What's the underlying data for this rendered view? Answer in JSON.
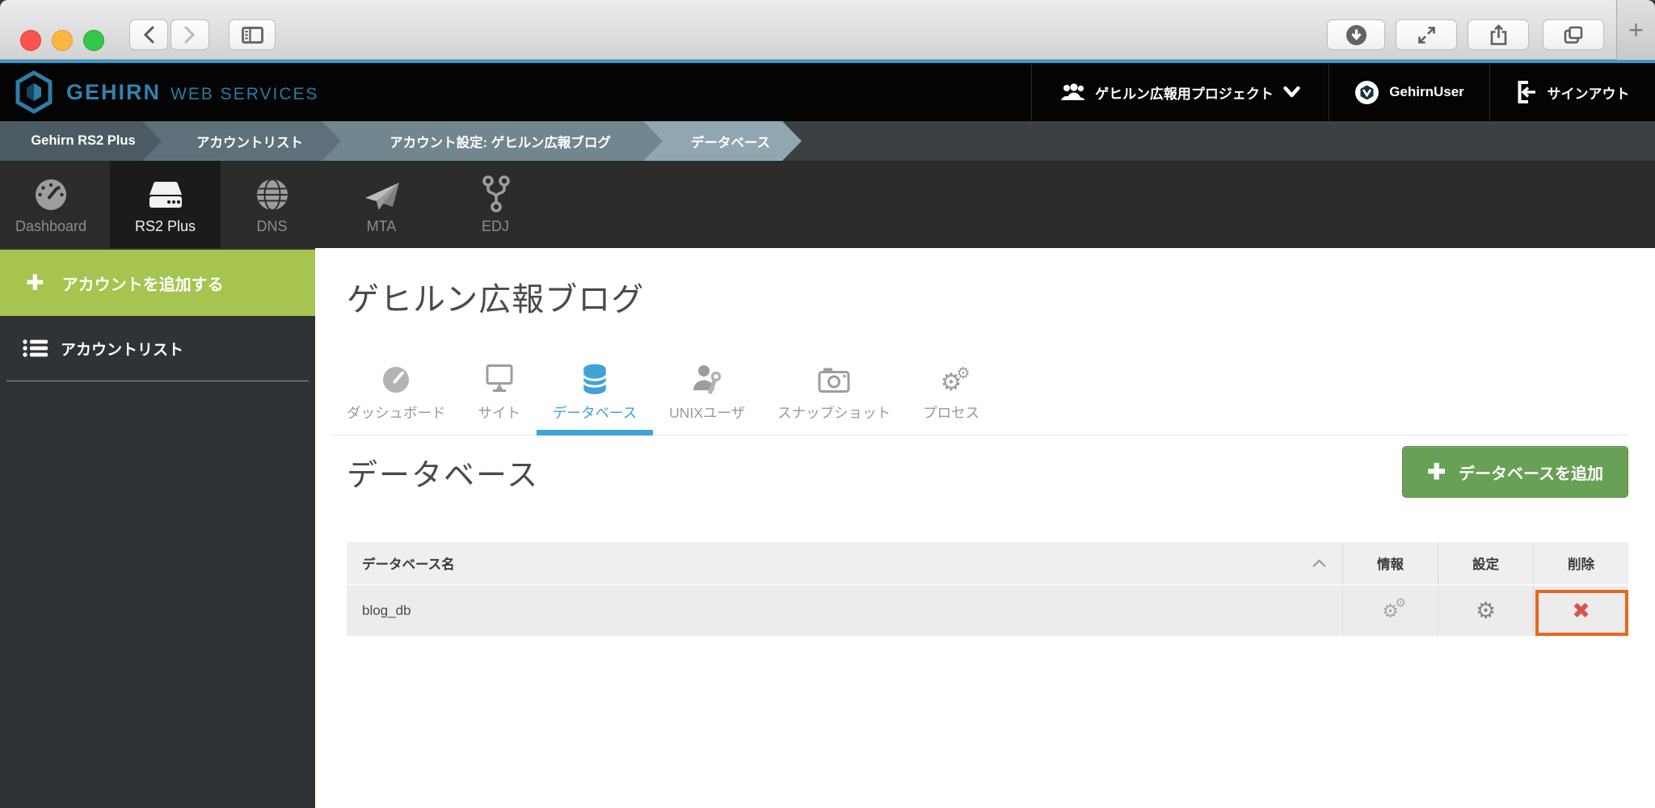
{
  "icons": {
    "gear": "⚙",
    "plus_heavy": "✚",
    "cross": "✖",
    "plus_thin": "+"
  },
  "colors": {
    "accent_blue": "#2e9fd4",
    "link_blue": "#3fa3d8",
    "brand_blue": "#2d7ea6",
    "sidebar_green": "#a6c44f",
    "button_green": "#68a155",
    "delete_red": "#d9534f",
    "highlight_orange": "#e8671c"
  },
  "header": {
    "brand": {
      "name": "GEHIRN",
      "suffix": "WEB SERVICES"
    },
    "project": {
      "label": "ゲヒルン広報用プロジェクト"
    },
    "user": {
      "name": "GehirnUser"
    },
    "signout_label": "サインアウト"
  },
  "breadcrumb": {
    "items": [
      "Gehirn RS2 Plus",
      "アカウントリスト",
      "アカウント設定: ゲヒルン広報ブログ",
      "データベース"
    ]
  },
  "service_nav": {
    "items": [
      {
        "label": "Dashboard",
        "icon": "gauge-icon",
        "active": false
      },
      {
        "label": "RS2 Plus",
        "icon": "server-icon",
        "active": true
      },
      {
        "label": "DNS",
        "icon": "globe-icon",
        "active": false
      },
      {
        "label": "MTA",
        "icon": "paper-plane-icon",
        "active": false
      },
      {
        "label": "EDJ",
        "icon": "fork-icon",
        "active": false
      }
    ]
  },
  "sidebar": {
    "add_account_label": "アカウントを追加する",
    "account_list_label": "アカウントリスト"
  },
  "main": {
    "page_title": "ゲヒルン広報ブログ",
    "tabs": [
      {
        "label": "ダッシュボード",
        "active": false
      },
      {
        "label": "サイト",
        "active": false
      },
      {
        "label": "データベース",
        "active": true
      },
      {
        "label": "UNIXユーザ",
        "active": false
      },
      {
        "label": "スナップショット",
        "active": false
      },
      {
        "label": "プロセス",
        "active": false
      }
    ],
    "section": {
      "title": "データベース",
      "add_button_label": "データベースを追加",
      "table": {
        "name_header": "データベース名",
        "action_headers": [
          "情報",
          "設定",
          "削除"
        ],
        "rows": [
          {
            "name": "blog_db"
          }
        ]
      }
    }
  }
}
